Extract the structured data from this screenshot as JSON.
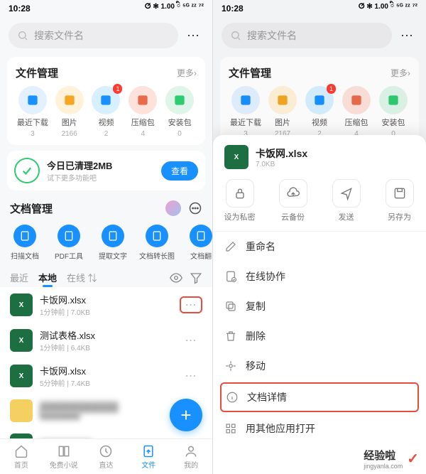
{
  "status": {
    "time": "10:28",
    "indicators": "ⵚ ✻ 1.00 ི ⁵ᴳ ᶻᶻ ⁷²"
  },
  "search": {
    "placeholder": "搜索文件名"
  },
  "fileMgmt": {
    "title": "文件管理",
    "more": "更多",
    "items_left": [
      {
        "label": "最近下载",
        "count": "3",
        "bg": "#e3f0ff",
        "fg": "#1890ff"
      },
      {
        "label": "图片",
        "count": "2166",
        "bg": "#fff2d9",
        "fg": "#f5a623"
      },
      {
        "label": "视频",
        "count": "2",
        "bg": "#d6f0ff",
        "fg": "#1890ff",
        "badge": "1"
      },
      {
        "label": "压缩包",
        "count": "4",
        "bg": "#fde2dc",
        "fg": "#e86c4a"
      },
      {
        "label": "安装包",
        "count": "0",
        "bg": "#e0f5e9",
        "fg": "#2ecc71"
      }
    ],
    "items_right": [
      {
        "label": "最近下载",
        "count": "3",
        "bg": "#e3f0ff",
        "fg": "#1890ff"
      },
      {
        "label": "图片",
        "count": "2167",
        "bg": "#fff2d9",
        "fg": "#f5a623"
      },
      {
        "label": "视频",
        "count": "2",
        "bg": "#d6f0ff",
        "fg": "#1890ff",
        "badge": "1"
      },
      {
        "label": "压缩包",
        "count": "4",
        "bg": "#fde2dc",
        "fg": "#e86c4a"
      },
      {
        "label": "安装包",
        "count": "0",
        "bg": "#e0f5e9",
        "fg": "#2ecc71"
      }
    ]
  },
  "clean": {
    "title": "今日已清理2MB",
    "sub": "试下更多功能吧",
    "btn": "查看"
  },
  "docMgmt": {
    "title": "文档管理",
    "tools": [
      {
        "label": "扫描文档"
      },
      {
        "label": "PDF工具"
      },
      {
        "label": "提取文字"
      },
      {
        "label": "文档转长图"
      },
      {
        "label": "文档翻"
      }
    ]
  },
  "tabs": {
    "recent": "最近",
    "local": "本地",
    "online": "在线 ⇅"
  },
  "files": [
    {
      "name": "卡饭网.xlsx",
      "meta": "1分钟前  |  7.0KB",
      "type": "xlsx",
      "highlight": true
    },
    {
      "name": "测试表格.xlsx",
      "meta": "1分钟前  |  6.4KB",
      "type": "xlsx"
    },
    {
      "name": "卡饭网.xlsx",
      "meta": "5分钟前  |  7.4KB",
      "type": "xlsx"
    },
    {
      "name": "████████████",
      "meta": "████████",
      "type": "yellow",
      "blurred": true
    },
    {
      "name": "████████.xlsx",
      "meta": "",
      "type": "xlsx",
      "blurred": true
    }
  ],
  "bottomNav": [
    {
      "label": "首页"
    },
    {
      "label": "免费小说"
    },
    {
      "label": "直达"
    },
    {
      "label": "文件",
      "active": true
    },
    {
      "label": "我的"
    }
  ],
  "sheet": {
    "fileName": "卡饭网.xlsx",
    "fileSize": "7.0KB",
    "actions": [
      {
        "label": "设为私密",
        "icon": "lock"
      },
      {
        "label": "云备份",
        "icon": "cloud"
      },
      {
        "label": "发送",
        "icon": "share"
      },
      {
        "label": "另存为",
        "icon": "save"
      }
    ],
    "items": [
      {
        "label": "重命名",
        "icon": "rename"
      },
      {
        "label": "在线协作",
        "icon": "collab"
      },
      {
        "label": "复制",
        "icon": "copy"
      },
      {
        "label": "删除",
        "icon": "delete"
      },
      {
        "label": "移动",
        "icon": "move"
      },
      {
        "label": "文档详情",
        "icon": "info",
        "highlight": true
      },
      {
        "label": "用其他应用打开",
        "icon": "grid"
      }
    ]
  },
  "watermark": {
    "title": "经验啦",
    "url": "jingyanla.com",
    "check": "✓"
  }
}
